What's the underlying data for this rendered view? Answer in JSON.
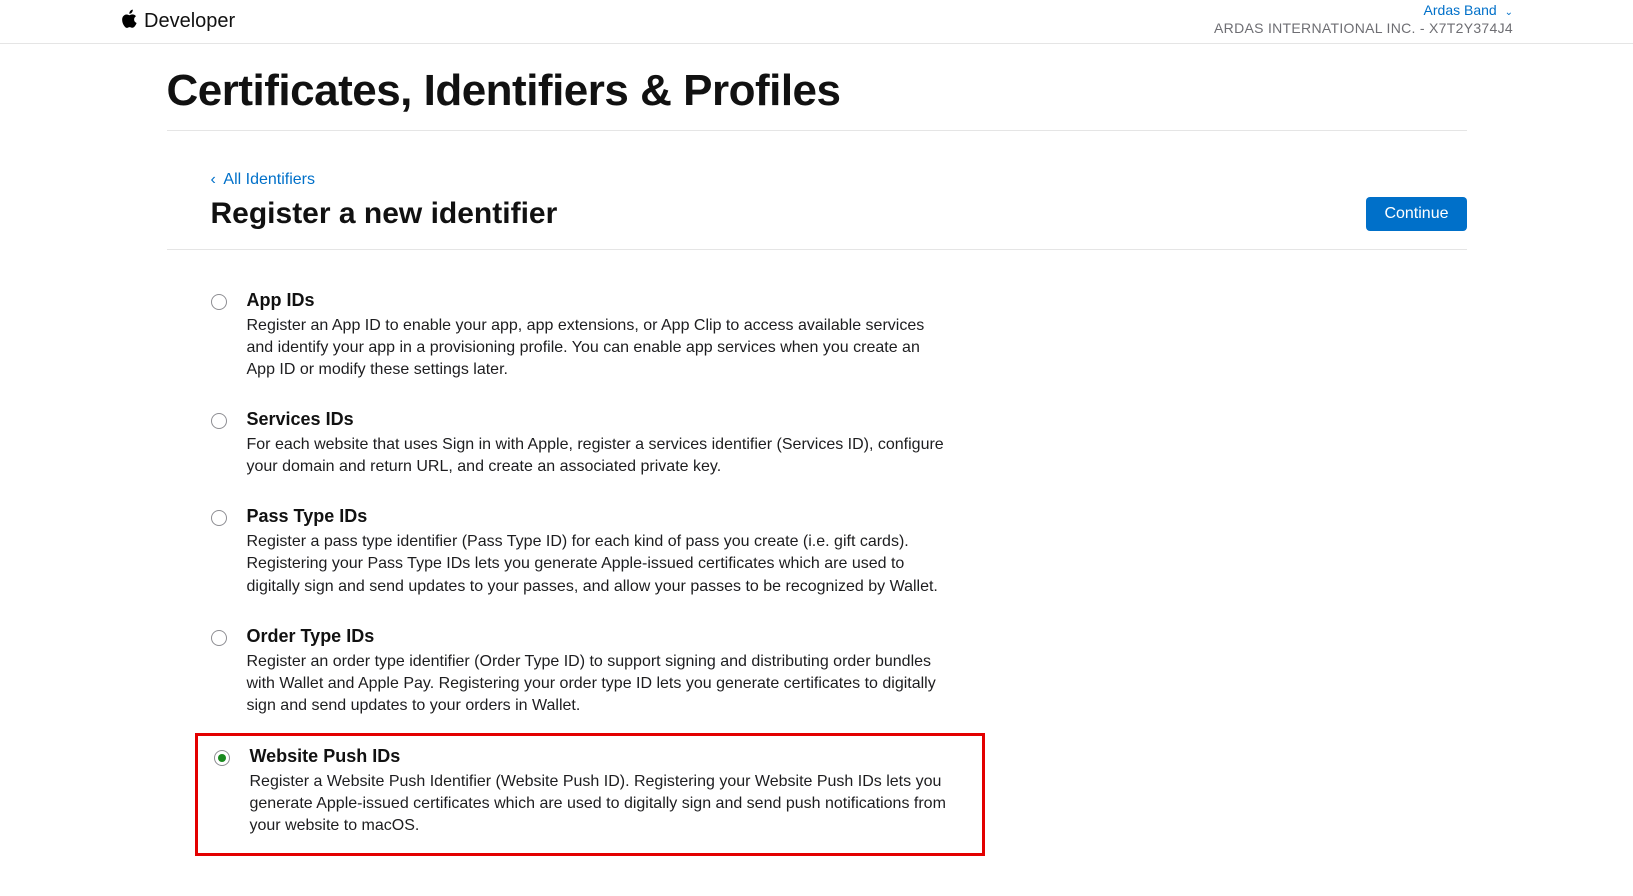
{
  "brand": {
    "label": "Developer"
  },
  "account": {
    "user": "Ardas Band",
    "team": "ARDAS INTERNATIONAL INC. - X7T2Y374J4"
  },
  "page": {
    "title": "Certificates, Identifiers & Profiles",
    "breadcrumb": "All Identifiers",
    "section_title": "Register a new identifier",
    "continue_label": "Continue"
  },
  "options": [
    {
      "id": "app-ids",
      "title": "App IDs",
      "desc": "Register an App ID to enable your app, app extensions, or App Clip to access available services and identify your app in a provisioning profile. You can enable app services when you create an App ID or modify these settings later.",
      "selected": false,
      "highlight": false
    },
    {
      "id": "services-ids",
      "title": "Services IDs",
      "desc": "For each website that uses Sign in with Apple, register a services identifier (Services ID), configure your domain and return URL, and create an associated private key.",
      "selected": false,
      "highlight": false
    },
    {
      "id": "pass-type-ids",
      "title": "Pass Type IDs",
      "desc": "Register a pass type identifier (Pass Type ID) for each kind of pass you create (i.e. gift cards). Registering your Pass Type IDs lets you generate Apple-issued certificates which are used to digitally sign and send updates to your passes, and allow your passes to be recognized by Wallet.",
      "selected": false,
      "highlight": false
    },
    {
      "id": "order-type-ids",
      "title": "Order Type IDs",
      "desc": "Register an order type identifier (Order Type ID) to support signing and distributing order bundles with Wallet and Apple Pay. Registering your order type ID lets you generate certificates to digitally sign and send updates to your orders in Wallet.",
      "selected": false,
      "highlight": false
    },
    {
      "id": "website-push-ids",
      "title": "Website Push IDs",
      "desc": "Register a Website Push Identifier (Website Push ID). Registering your Website Push IDs lets you generate Apple-issued certificates which are used to digitally sign and send push notifications from your website to macOS.",
      "selected": true,
      "highlight": true
    }
  ]
}
